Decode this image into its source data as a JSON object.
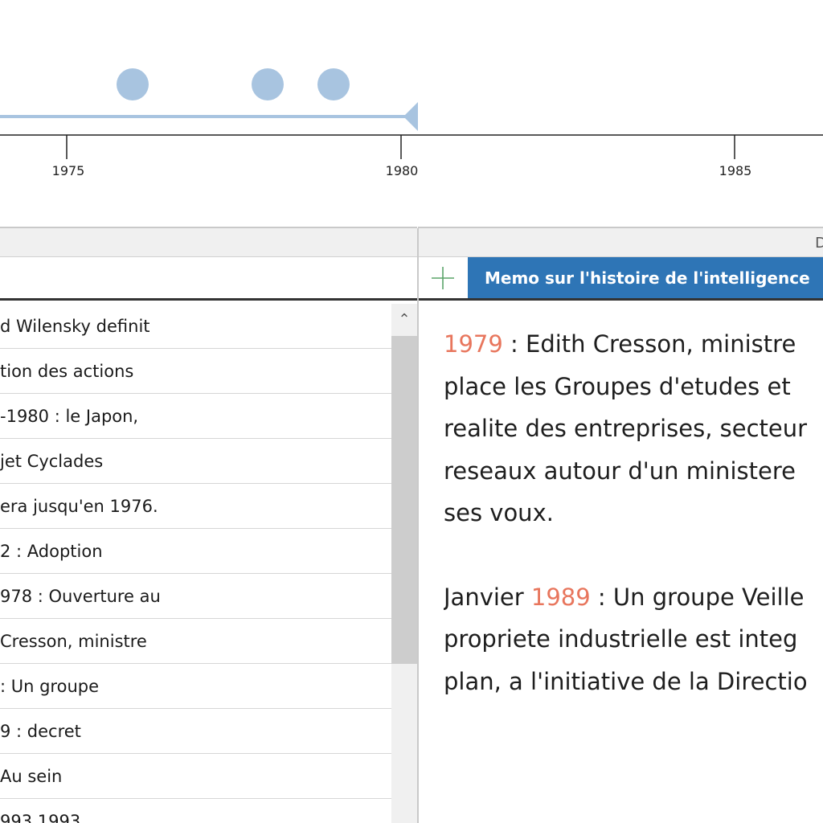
{
  "timeline": {
    "axis_labels": [
      "1975",
      "1980",
      "1985"
    ],
    "range_color": "#a8c4e0",
    "dot_color": "#a8c4e0",
    "dot_years": [
      1977,
      1979,
      1980
    ]
  },
  "columns": {
    "right_header": "D"
  },
  "list": {
    "rows": [
      "d Wilensky definit",
      "tion des actions",
      "-1980 : le Japon,",
      "jet Cyclades",
      "era jusqu'en 1976.",
      "2 : Adoption",
      "978 : Ouverture au",
      "Cresson, ministre",
      ": Un groupe",
      "9 : decret",
      "Au sein",
      "993          1993"
    ]
  },
  "scrollbar": {
    "up_glyph": "⌃"
  },
  "tabs": {
    "add_icon": "plus-icon",
    "memo_title": "Memo sur l'histoire de l'intelligence"
  },
  "memo": {
    "p1_year": "1979",
    "p1_line1": " : Edith Cresson, ministre",
    "p1_line2": "place les Groupes d'etudes et ",
    "p1_line3": "realite des entreprises, secteur",
    "p1_line4": "reseaux autour d'un ministere",
    "p1_line5": "ses voux.",
    "p2_prefix": "Janvier ",
    "p2_year": "1989",
    "p2_line1": " : Un groupe Veille",
    "p2_line2": "propriete industrielle est integ",
    "p2_line3": "plan, a l'initiative de la Directio"
  },
  "colors": {
    "accent_tab": "#2e75b6",
    "year_highlight": "#e8765d"
  }
}
